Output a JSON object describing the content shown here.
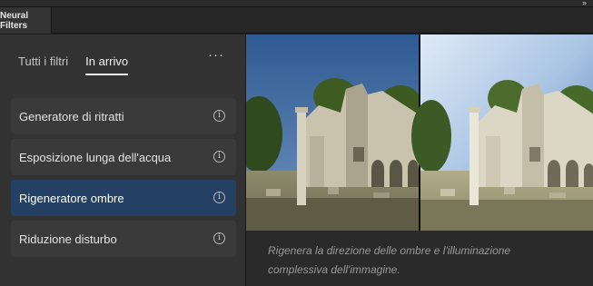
{
  "panel": {
    "tab_label": "Neural Filters",
    "collapse_icon": "double-chevron-right-icon"
  },
  "filter_tabs": [
    {
      "label": "Tutti i filtri",
      "active": false
    },
    {
      "label": "In arrivo",
      "active": true
    }
  ],
  "more_label": "···",
  "filters": [
    {
      "label": "Generatore di ritratti",
      "selected": false
    },
    {
      "label": "Esposizione lunga dell'acqua",
      "selected": false
    },
    {
      "label": "Rigeneratore ombre",
      "selected": true
    },
    {
      "label": "Riduzione disturbo",
      "selected": false
    }
  ],
  "info_glyph": "i",
  "preview": {
    "description": "Rigenera la direzione delle ombre e l'illuminazione complessiva dell'immagine."
  },
  "colors": {
    "selected": "#244062",
    "panel": "#323232",
    "sky_before": "#3d6396",
    "sky_after": "#aac6e6"
  }
}
